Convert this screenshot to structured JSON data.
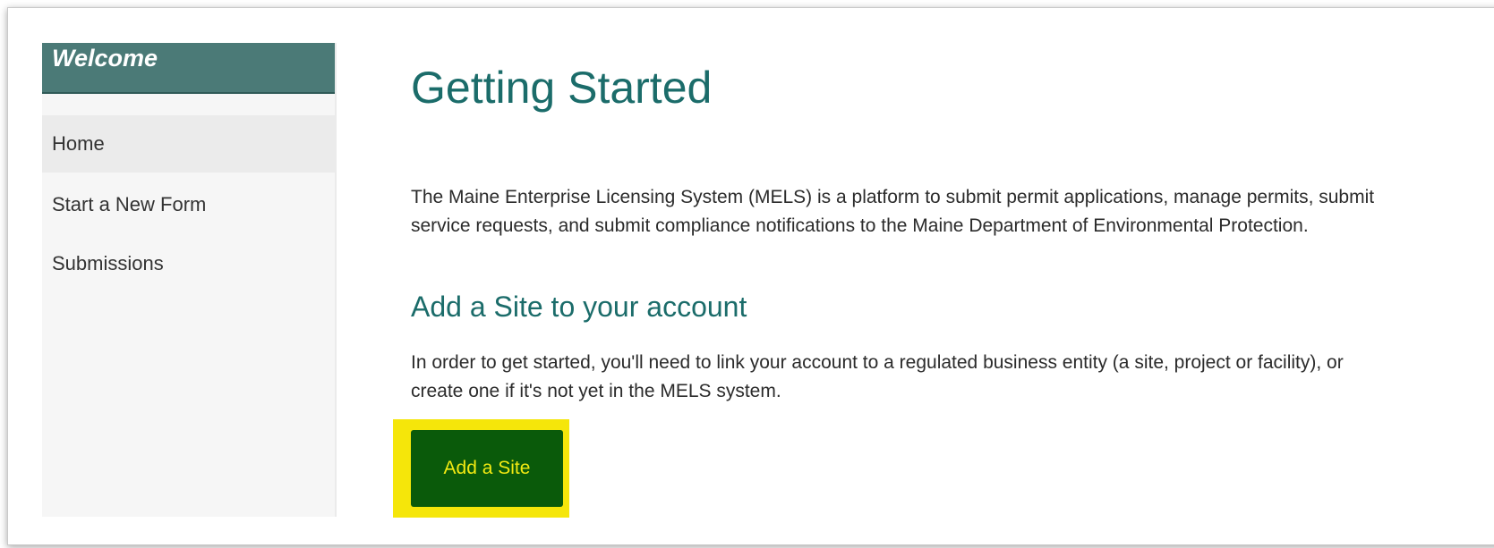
{
  "sidebar": {
    "header": "Welcome",
    "items": [
      {
        "label": "Home",
        "active": true
      },
      {
        "label": "Start a New Form",
        "active": false
      },
      {
        "label": "Submissions",
        "active": false
      }
    ]
  },
  "main": {
    "title": "Getting Started",
    "intro_line1": "The Maine Enterprise Licensing System (MELS) is a platform to submit permit applications, manage permits, submit",
    "intro_line2": "service requests, and submit compliance notifications to the Maine Department of Environmental Protection.",
    "section_title": "Add a Site to your account",
    "section_line1": "In order to get started, you'll need to link your account to a regulated business entity (a site, project or facility), or",
    "section_line2": "create one if it's not yet in the MELS system.",
    "button_label": "Add a Site"
  },
  "colors": {
    "accent_teal": "#1b6c6a",
    "header_bg": "#4b7a77",
    "button_bg": "#0a5a0a",
    "button_text": "#f2ea12",
    "highlight": "#f5e60a"
  }
}
